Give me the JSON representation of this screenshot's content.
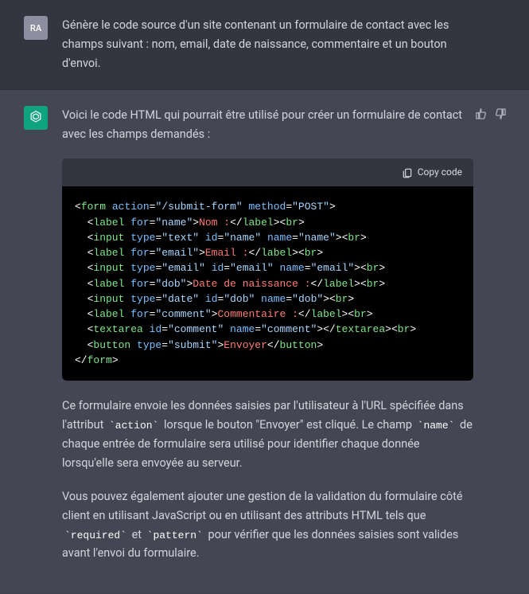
{
  "user": {
    "avatar_text": "RA",
    "message": "Génère le code source d'un site contenant un formulaire de contact avec les champs suivant : nom, email, date de naissance, commentaire et un bouton d'envoi."
  },
  "bot": {
    "intro": "Voici le code HTML qui pourrait être utilisé pour créer un formulaire de contact avec les champs demandés :",
    "copy_label": "Copy code",
    "code_tokens": [
      {
        "c": "t-plain",
        "t": "<"
      },
      {
        "c": "t-tag",
        "t": "form"
      },
      {
        "c": "t-plain",
        "t": " "
      },
      {
        "c": "t-attr",
        "t": "action"
      },
      {
        "c": "t-plain",
        "t": "="
      },
      {
        "c": "t-str",
        "t": "\"/submit-form\""
      },
      {
        "c": "t-plain",
        "t": " "
      },
      {
        "c": "t-attr",
        "t": "method"
      },
      {
        "c": "t-plain",
        "t": "="
      },
      {
        "c": "t-str",
        "t": "\"POST\""
      },
      {
        "c": "t-plain",
        "t": ">"
      },
      {
        "nl": true
      },
      {
        "c": "t-plain",
        "t": "  <"
      },
      {
        "c": "t-tag",
        "t": "label"
      },
      {
        "c": "t-plain",
        "t": " "
      },
      {
        "c": "t-attr",
        "t": "for"
      },
      {
        "c": "t-plain",
        "t": "="
      },
      {
        "c": "t-str",
        "t": "\"name\""
      },
      {
        "c": "t-plain",
        "t": ">"
      },
      {
        "c": "t-text",
        "t": "Nom :"
      },
      {
        "c": "t-plain",
        "t": "</"
      },
      {
        "c": "t-tag",
        "t": "label"
      },
      {
        "c": "t-plain",
        "t": "><"
      },
      {
        "c": "t-tag",
        "t": "br"
      },
      {
        "c": "t-plain",
        "t": ">"
      },
      {
        "nl": true
      },
      {
        "c": "t-plain",
        "t": "  <"
      },
      {
        "c": "t-tag",
        "t": "input"
      },
      {
        "c": "t-plain",
        "t": " "
      },
      {
        "c": "t-attr",
        "t": "type"
      },
      {
        "c": "t-plain",
        "t": "="
      },
      {
        "c": "t-str",
        "t": "\"text\""
      },
      {
        "c": "t-plain",
        "t": " "
      },
      {
        "c": "t-attr",
        "t": "id"
      },
      {
        "c": "t-plain",
        "t": "="
      },
      {
        "c": "t-str",
        "t": "\"name\""
      },
      {
        "c": "t-plain",
        "t": " "
      },
      {
        "c": "t-attr",
        "t": "name"
      },
      {
        "c": "t-plain",
        "t": "="
      },
      {
        "c": "t-str",
        "t": "\"name\""
      },
      {
        "c": "t-plain",
        "t": "><"
      },
      {
        "c": "t-tag",
        "t": "br"
      },
      {
        "c": "t-plain",
        "t": ">"
      },
      {
        "nl": true
      },
      {
        "c": "t-plain",
        "t": "  <"
      },
      {
        "c": "t-tag",
        "t": "label"
      },
      {
        "c": "t-plain",
        "t": " "
      },
      {
        "c": "t-attr",
        "t": "for"
      },
      {
        "c": "t-plain",
        "t": "="
      },
      {
        "c": "t-str",
        "t": "\"email\""
      },
      {
        "c": "t-plain",
        "t": ">"
      },
      {
        "c": "t-text",
        "t": "Email :"
      },
      {
        "c": "t-plain",
        "t": "</"
      },
      {
        "c": "t-tag",
        "t": "label"
      },
      {
        "c": "t-plain",
        "t": "><"
      },
      {
        "c": "t-tag",
        "t": "br"
      },
      {
        "c": "t-plain",
        "t": ">"
      },
      {
        "nl": true
      },
      {
        "c": "t-plain",
        "t": "  <"
      },
      {
        "c": "t-tag",
        "t": "input"
      },
      {
        "c": "t-plain",
        "t": " "
      },
      {
        "c": "t-attr",
        "t": "type"
      },
      {
        "c": "t-plain",
        "t": "="
      },
      {
        "c": "t-str",
        "t": "\"email\""
      },
      {
        "c": "t-plain",
        "t": " "
      },
      {
        "c": "t-attr",
        "t": "id"
      },
      {
        "c": "t-plain",
        "t": "="
      },
      {
        "c": "t-str",
        "t": "\"email\""
      },
      {
        "c": "t-plain",
        "t": " "
      },
      {
        "c": "t-attr",
        "t": "name"
      },
      {
        "c": "t-plain",
        "t": "="
      },
      {
        "c": "t-str",
        "t": "\"email\""
      },
      {
        "c": "t-plain",
        "t": "><"
      },
      {
        "c": "t-tag",
        "t": "br"
      },
      {
        "c": "t-plain",
        "t": ">"
      },
      {
        "nl": true
      },
      {
        "c": "t-plain",
        "t": "  <"
      },
      {
        "c": "t-tag",
        "t": "label"
      },
      {
        "c": "t-plain",
        "t": " "
      },
      {
        "c": "t-attr",
        "t": "for"
      },
      {
        "c": "t-plain",
        "t": "="
      },
      {
        "c": "t-str",
        "t": "\"dob\""
      },
      {
        "c": "t-plain",
        "t": ">"
      },
      {
        "c": "t-text",
        "t": "Date de naissance :"
      },
      {
        "c": "t-plain",
        "t": "</"
      },
      {
        "c": "t-tag",
        "t": "label"
      },
      {
        "c": "t-plain",
        "t": "><"
      },
      {
        "c": "t-tag",
        "t": "br"
      },
      {
        "c": "t-plain",
        "t": ">"
      },
      {
        "nl": true
      },
      {
        "c": "t-plain",
        "t": "  <"
      },
      {
        "c": "t-tag",
        "t": "input"
      },
      {
        "c": "t-plain",
        "t": " "
      },
      {
        "c": "t-attr",
        "t": "type"
      },
      {
        "c": "t-plain",
        "t": "="
      },
      {
        "c": "t-str",
        "t": "\"date\""
      },
      {
        "c": "t-plain",
        "t": " "
      },
      {
        "c": "t-attr",
        "t": "id"
      },
      {
        "c": "t-plain",
        "t": "="
      },
      {
        "c": "t-str",
        "t": "\"dob\""
      },
      {
        "c": "t-plain",
        "t": " "
      },
      {
        "c": "t-attr",
        "t": "name"
      },
      {
        "c": "t-plain",
        "t": "="
      },
      {
        "c": "t-str",
        "t": "\"dob\""
      },
      {
        "c": "t-plain",
        "t": "><"
      },
      {
        "c": "t-tag",
        "t": "br"
      },
      {
        "c": "t-plain",
        "t": ">"
      },
      {
        "nl": true
      },
      {
        "c": "t-plain",
        "t": "  <"
      },
      {
        "c": "t-tag",
        "t": "label"
      },
      {
        "c": "t-plain",
        "t": " "
      },
      {
        "c": "t-attr",
        "t": "for"
      },
      {
        "c": "t-plain",
        "t": "="
      },
      {
        "c": "t-str",
        "t": "\"comment\""
      },
      {
        "c": "t-plain",
        "t": ">"
      },
      {
        "c": "t-text",
        "t": "Commentaire :"
      },
      {
        "c": "t-plain",
        "t": "</"
      },
      {
        "c": "t-tag",
        "t": "label"
      },
      {
        "c": "t-plain",
        "t": "><"
      },
      {
        "c": "t-tag",
        "t": "br"
      },
      {
        "c": "t-plain",
        "t": ">"
      },
      {
        "nl": true
      },
      {
        "c": "t-plain",
        "t": "  <"
      },
      {
        "c": "t-tag",
        "t": "textarea"
      },
      {
        "c": "t-plain",
        "t": " "
      },
      {
        "c": "t-attr",
        "t": "id"
      },
      {
        "c": "t-plain",
        "t": "="
      },
      {
        "c": "t-str",
        "t": "\"comment\""
      },
      {
        "c": "t-plain",
        "t": " "
      },
      {
        "c": "t-attr",
        "t": "name"
      },
      {
        "c": "t-plain",
        "t": "="
      },
      {
        "c": "t-str",
        "t": "\"comment\""
      },
      {
        "c": "t-plain",
        "t": "></"
      },
      {
        "c": "t-tag",
        "t": "textarea"
      },
      {
        "c": "t-plain",
        "t": "><"
      },
      {
        "c": "t-tag",
        "t": "br"
      },
      {
        "c": "t-plain",
        "t": ">"
      },
      {
        "nl": true
      },
      {
        "c": "t-plain",
        "t": "  <"
      },
      {
        "c": "t-tag",
        "t": "button"
      },
      {
        "c": "t-plain",
        "t": " "
      },
      {
        "c": "t-attr",
        "t": "type"
      },
      {
        "c": "t-plain",
        "t": "="
      },
      {
        "c": "t-str",
        "t": "\"submit\""
      },
      {
        "c": "t-plain",
        "t": ">"
      },
      {
        "c": "t-text",
        "t": "Envoyer"
      },
      {
        "c": "t-plain",
        "t": "</"
      },
      {
        "c": "t-tag",
        "t": "button"
      },
      {
        "c": "t-plain",
        "t": ">"
      },
      {
        "nl": true
      },
      {
        "c": "t-plain",
        "t": "</"
      },
      {
        "c": "t-tag",
        "t": "form"
      },
      {
        "c": "t-plain",
        "t": ">"
      }
    ],
    "para1_parts": [
      {
        "t": "Ce formulaire envoie les données saisies par l'utilisateur à l'URL spécifiée dans l'attribut "
      },
      {
        "code": true,
        "t": "`action`"
      },
      {
        "t": " lorsque le bouton \"Envoyer\" est cliqué. Le champ "
      },
      {
        "code": true,
        "t": "`name`"
      },
      {
        "t": " de chaque entrée de formulaire sera utilisé pour identifier chaque donnée lorsqu'elle sera envoyée au serveur."
      }
    ],
    "para2_parts": [
      {
        "t": "Vous pouvez également ajouter une gestion de la validation du formulaire côté client en utilisant JavaScript ou en utilisant des attributs HTML tels que "
      },
      {
        "code": true,
        "t": "`required`"
      },
      {
        "t": " et "
      },
      {
        "code": true,
        "t": "`pattern`"
      },
      {
        "t": " pour vérifier que les données saisies sont valides avant l'envoi du formulaire."
      }
    ]
  }
}
